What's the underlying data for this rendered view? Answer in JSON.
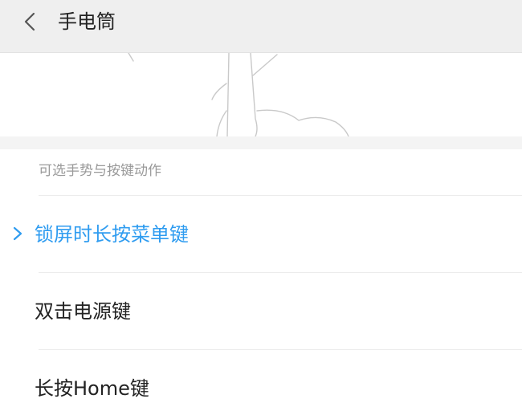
{
  "header": {
    "back_icon": "chevron-left-icon",
    "title": "手电筒"
  },
  "illustration": {
    "icon": "flashlight-hand-illustration"
  },
  "section": {
    "label": "可选手势与按键动作"
  },
  "options": [
    {
      "label": "锁屏时长按菜单键",
      "selected": true
    },
    {
      "label": "双击电源键",
      "selected": false
    },
    {
      "label": "长按Home键",
      "selected": false
    }
  ],
  "colors": {
    "accent": "#2f9cf0",
    "text": "#222222",
    "secondary_text": "#9a9a9a",
    "header_bg": "#efefef"
  }
}
